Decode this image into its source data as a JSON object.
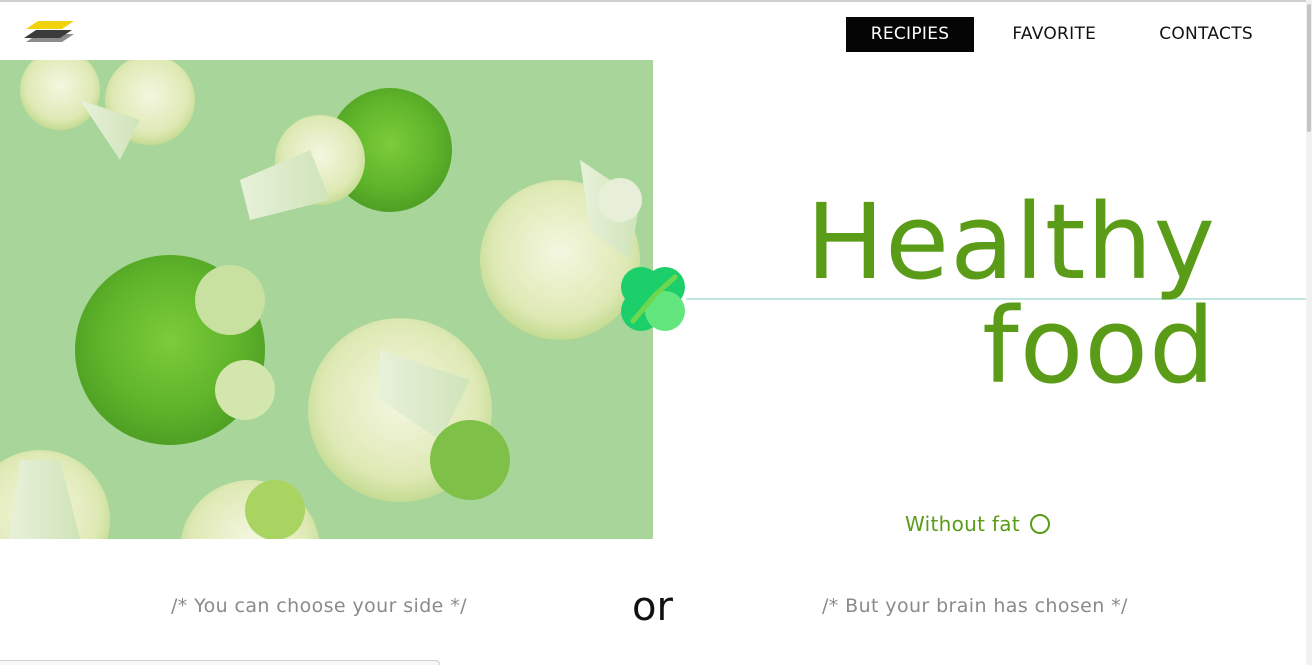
{
  "header": {
    "logo_icon": "layers-logo-icon",
    "nav": [
      {
        "label": "RECIPIES",
        "active": true
      },
      {
        "label": "FAVORITE",
        "active": false
      },
      {
        "label": "CONTACTS",
        "active": false
      }
    ]
  },
  "hero": {
    "title_line1": "Healthy",
    "title_line2": "food",
    "badge_icon": "clover-leaf-icon",
    "image_subject": "cauliflower-broccoli-image"
  },
  "filter": {
    "label": "Without fat",
    "checked": false
  },
  "choice": {
    "left_comment": "/* You can choose your side */",
    "or_label": "or",
    "right_comment": "/* But your brain has chosen */"
  },
  "colors": {
    "accent_green": "#5a9c17",
    "nav_active_bg": "#050505",
    "logo_yellow": "#f2d20a",
    "badge_green": "#1fd36b",
    "hero_bg": "#a9d79a"
  }
}
